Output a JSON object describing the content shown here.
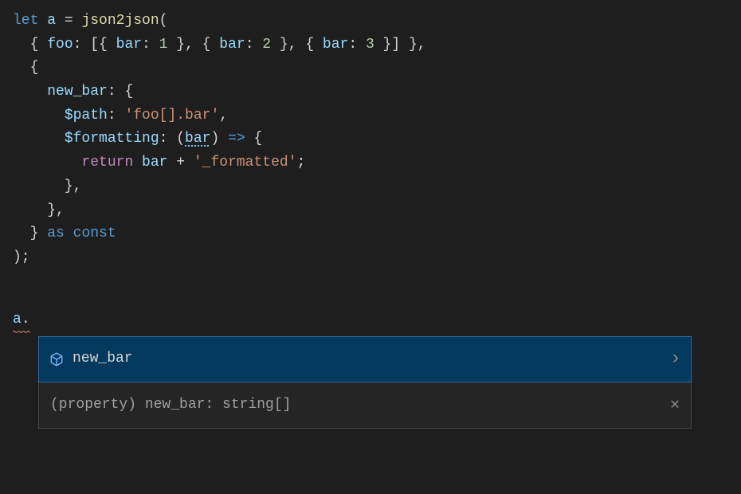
{
  "code": {
    "line1": {
      "let": "let",
      "varname": "a",
      "eq": " = ",
      "fn": "json2json",
      "open": "("
    },
    "line2_prefix": "  { ",
    "line2_foo": "foo",
    "line2_colon": ": ",
    "line2_bracket_open": "[{ ",
    "line2_bar1": "bar",
    "line2_colon2": ": ",
    "line2_num1": "1",
    "line2_sep1": " }, { ",
    "line2_bar2": "bar",
    "line2_colon3": ": ",
    "line2_num2": "2",
    "line2_sep2": " }, { ",
    "line2_bar3": "bar",
    "line2_colon4": ": ",
    "line2_num3": "3",
    "line2_close": " }] },",
    "line3": "  {",
    "line4_indent": "    ",
    "line4_prop": "new_bar",
    "line4_rest": ": {",
    "line5_indent": "      ",
    "line5_prop": "$path",
    "line5_colon": ": ",
    "line5_str": "'foo[].bar'",
    "line5_comma": ",",
    "line6_indent": "      ",
    "line6_prop": "$formatting",
    "line6_colon": ": (",
    "line6_param": "bar",
    "line6_close": ") ",
    "line6_arrow": "=>",
    "line6_brace": " {",
    "line7_indent": "        ",
    "line7_return": "return",
    "line7_sp": " ",
    "line7_var": "bar",
    "line7_plus": " + ",
    "line7_str": "'_formatted'",
    "line7_semi": ";",
    "line8": "      },",
    "line9": "    },",
    "line10_indent": "  } ",
    "line10_as": "as",
    "line10_sp": " ",
    "line10_const": "const",
    "line11": ");",
    "trigger_var": "a",
    "trigger_dot": "."
  },
  "suggestion": {
    "label": "new_bar",
    "detail": "(property) new_bar: string[]"
  }
}
